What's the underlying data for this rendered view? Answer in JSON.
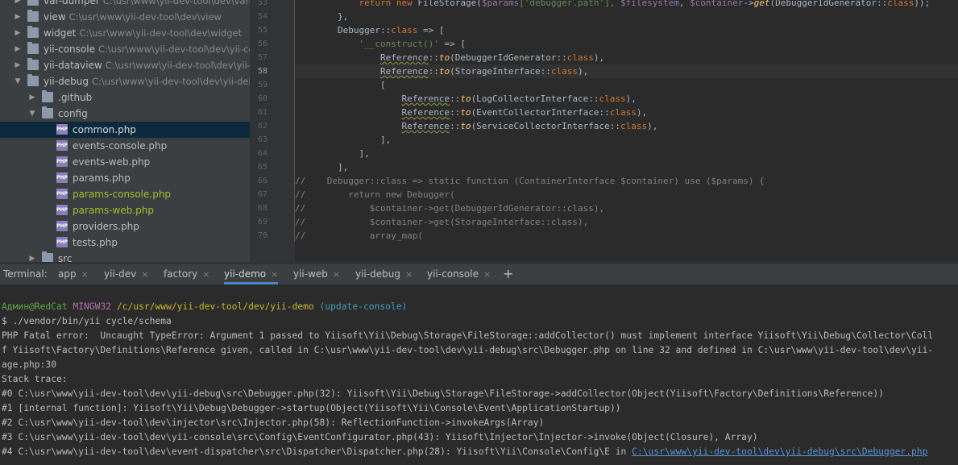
{
  "tree": [
    {
      "name": "var-dumper",
      "path": "C:\\usr\\www\\yii-dev-tool\\dev\\var-dumper",
      "type": "folder",
      "arrow": "right",
      "indent": 0,
      "style": "normal"
    },
    {
      "name": "view",
      "path": "C:\\usr\\www\\yii-dev-tool\\dev\\view",
      "type": "folder",
      "arrow": "right",
      "indent": 0,
      "style": "normal"
    },
    {
      "name": "widget",
      "path": "C:\\usr\\www\\yii-dev-tool\\dev\\widget",
      "type": "folder",
      "arrow": "right",
      "indent": 0,
      "style": "normal"
    },
    {
      "name": "yii-console",
      "path": "C:\\usr\\www\\yii-dev-tool\\dev\\yii-console",
      "type": "folder",
      "arrow": "right",
      "indent": 0,
      "style": "normal"
    },
    {
      "name": "yii-dataview",
      "path": "C:\\usr\\www\\yii-dev-tool\\dev\\yii-dataview",
      "type": "folder",
      "arrow": "right",
      "indent": 0,
      "style": "normal"
    },
    {
      "name": "yii-debug",
      "path": "C:\\usr\\www\\yii-dev-tool\\dev\\yii-debug",
      "type": "folder",
      "arrow": "down",
      "indent": 0,
      "style": "normal"
    },
    {
      "name": ".github",
      "path": "",
      "type": "folder",
      "arrow": "right",
      "indent": 1,
      "style": "normal"
    },
    {
      "name": "config",
      "path": "",
      "type": "folder",
      "arrow": "down",
      "indent": 1,
      "style": "normal"
    },
    {
      "name": "common.php",
      "path": "",
      "type": "php",
      "arrow": "",
      "indent": 2,
      "style": "white",
      "selected": true
    },
    {
      "name": "events-console.php",
      "path": "",
      "type": "php",
      "arrow": "",
      "indent": 2,
      "style": "normal"
    },
    {
      "name": "events-web.php",
      "path": "",
      "type": "php",
      "arrow": "",
      "indent": 2,
      "style": "normal"
    },
    {
      "name": "params.php",
      "path": "",
      "type": "php",
      "arrow": "",
      "indent": 2,
      "style": "normal"
    },
    {
      "name": "params-console.php",
      "path": "",
      "type": "php",
      "arrow": "",
      "indent": 2,
      "style": "green"
    },
    {
      "name": "params-web.php",
      "path": "",
      "type": "php",
      "arrow": "",
      "indent": 2,
      "style": "green"
    },
    {
      "name": "providers.php",
      "path": "",
      "type": "php",
      "arrow": "",
      "indent": 2,
      "style": "normal"
    },
    {
      "name": "tests.php",
      "path": "",
      "type": "php",
      "arrow": "",
      "indent": 2,
      "style": "normal"
    },
    {
      "name": "src",
      "path": "",
      "type": "folder",
      "arrow": "right",
      "indent": 1,
      "style": "normal"
    }
  ],
  "editor": {
    "current_line": 58,
    "lines": [
      {
        "n": "53",
        "segs": [
          [
            "            ",
            "p"
          ],
          [
            "return new ",
            "kw"
          ],
          [
            "FileStorage(",
            "p"
          ],
          [
            "$params",
            "var"
          ],
          [
            "['debugger.path'], ",
            "st"
          ],
          [
            "$filesystem",
            "var"
          ],
          [
            ", ",
            "p"
          ],
          [
            "$container",
            "var"
          ],
          [
            "->",
            "p"
          ],
          [
            "get",
            "fn"
          ],
          [
            "(DebuggerIdGenerator::",
            "p"
          ],
          [
            "class",
            "kw"
          ],
          [
            "));",
            "p"
          ]
        ]
      },
      {
        "n": "54",
        "segs": [
          [
            "        },",
            "p"
          ]
        ]
      },
      {
        "n": "55",
        "segs": [
          [
            "        Debugger::",
            "p"
          ],
          [
            "class",
            "kw"
          ],
          [
            " => [",
            "p"
          ]
        ]
      },
      {
        "n": "56",
        "segs": [
          [
            "            ",
            "p"
          ],
          [
            "'__construct()'",
            "st"
          ],
          [
            " => [",
            "p"
          ]
        ]
      },
      {
        "n": "57",
        "segs": [
          [
            "                ",
            "p"
          ],
          [
            "Reference",
            "under"
          ],
          [
            "::",
            "p"
          ],
          [
            "to",
            "fn"
          ],
          [
            "(DebuggerIdGenerator::",
            "p"
          ],
          [
            "class",
            "kw"
          ],
          [
            "),",
            "p"
          ]
        ]
      },
      {
        "n": "58",
        "segs": [
          [
            "                ",
            "p"
          ],
          [
            "Reference",
            "under"
          ],
          [
            "::",
            "p"
          ],
          [
            "to",
            "fn"
          ],
          [
            "(StorageInterface::",
            "p"
          ],
          [
            "class",
            "kw"
          ],
          [
            "),",
            "p"
          ]
        ]
      },
      {
        "n": "59",
        "segs": [
          [
            "                [",
            "p"
          ]
        ]
      },
      {
        "n": "60",
        "segs": [
          [
            "                    ",
            "p"
          ],
          [
            "Reference",
            "under"
          ],
          [
            "::",
            "p"
          ],
          [
            "to",
            "fn"
          ],
          [
            "(LogCollectorInterface::",
            "p"
          ],
          [
            "class",
            "kw"
          ],
          [
            "),",
            "p"
          ]
        ]
      },
      {
        "n": "61",
        "segs": [
          [
            "                    ",
            "p"
          ],
          [
            "Reference",
            "under"
          ],
          [
            "::",
            "p"
          ],
          [
            "to",
            "fn"
          ],
          [
            "(EventCollectorInterface::",
            "p"
          ],
          [
            "class",
            "kw"
          ],
          [
            "),",
            "p"
          ]
        ]
      },
      {
        "n": "62",
        "segs": [
          [
            "                    ",
            "p"
          ],
          [
            "Reference",
            "under"
          ],
          [
            "::",
            "p"
          ],
          [
            "to",
            "fn"
          ],
          [
            "(ServiceCollectorInterface::",
            "p"
          ],
          [
            "class",
            "kw"
          ],
          [
            "),",
            "p"
          ]
        ]
      },
      {
        "n": "63",
        "segs": [
          [
            "                ],",
            "p"
          ]
        ]
      },
      {
        "n": "64",
        "segs": [
          [
            "            ],",
            "p"
          ]
        ]
      },
      {
        "n": "65",
        "segs": [
          [
            "        ],",
            "p"
          ]
        ]
      },
      {
        "n": "66",
        "segs": [
          [
            "//    Debugger::class => static function (ContainerInterface $container) use ($params) {",
            "cm"
          ]
        ]
      },
      {
        "n": "67",
        "segs": [
          [
            "//        return new Debugger(",
            "cm"
          ]
        ]
      },
      {
        "n": "68",
        "segs": [
          [
            "//            $container->get(DebuggerIdGenerator::class),",
            "cm"
          ]
        ]
      },
      {
        "n": "69",
        "segs": [
          [
            "//            $container->get(StorageInterface::class),",
            "cm"
          ]
        ]
      },
      {
        "n": "70",
        "segs": [
          [
            "//            array_map(",
            "cm"
          ]
        ]
      }
    ]
  },
  "terminal": {
    "label": "Terminal:",
    "tabs": [
      {
        "label": "app",
        "active": false
      },
      {
        "label": "yii-dev",
        "active": false
      },
      {
        "label": "factory",
        "active": false
      },
      {
        "label": "yii-demo",
        "active": true
      },
      {
        "label": "yii-web",
        "active": false
      },
      {
        "label": "yii-debug",
        "active": false
      },
      {
        "label": "yii-console",
        "active": false
      }
    ],
    "add_label": "+",
    "close_glyph": "×",
    "prompt": {
      "user": "Админ@RedCat",
      "system": "MINGW32",
      "cwd": "/c/usr/www/yii-dev-tool/dev/yii-demo",
      "branch": "(update-console)"
    },
    "lines": [
      "$ ./vendor/bin/yii cycle/schema",
      "PHP Fatal error:  Uncaught TypeError: Argument 1 passed to Yiisoft\\Yii\\Debug\\Storage\\FileStorage::addCollector() must implement interface Yiisoft\\Yii\\Debug\\Collector\\Coll",
      "f Yiisoft\\Factory\\Definitions\\Reference given, called in C:\\usr\\www\\yii-dev-tool\\dev\\yii-debug\\src\\Debugger.php on line 32 and defined in C:\\usr\\www\\yii-dev-tool\\dev\\yii-",
      "age.php:30",
      "Stack trace:",
      "#0 C:\\usr\\www\\yii-dev-tool\\dev\\yii-debug\\src\\Debugger.php(32): Yiisoft\\Yii\\Debug\\Storage\\FileStorage->addCollector(Object(Yiisoft\\Factory\\Definitions\\Reference))",
      "#1 [internal function]: Yiisoft\\Yii\\Debug\\Debugger->startup(Object(Yiisoft\\Yii\\Console\\Event\\ApplicationStartup))",
      "#2 C:\\usr\\www\\yii-dev-tool\\dev\\injector\\src\\Injector.php(58): ReflectionFunction->invokeArgs(Array)",
      "#3 C:\\usr\\www\\yii-dev-tool\\dev\\yii-console\\src\\Config\\EventConfigurator.php(43): Yiisoft\\Injector\\Injector->invoke(Object(Closure), Array)"
    ],
    "last_line_prefix": "#4 C:\\usr\\www\\yii-dev-tool\\dev\\event-dispatcher\\src\\Dispatcher\\Dispatcher.php(28): Yiisoft\\Yii\\Console\\Config\\E in ",
    "last_line_link": "C:\\usr\\www\\yii-dev-tool\\dev\\yii-debug\\src\\Debugger.php"
  }
}
